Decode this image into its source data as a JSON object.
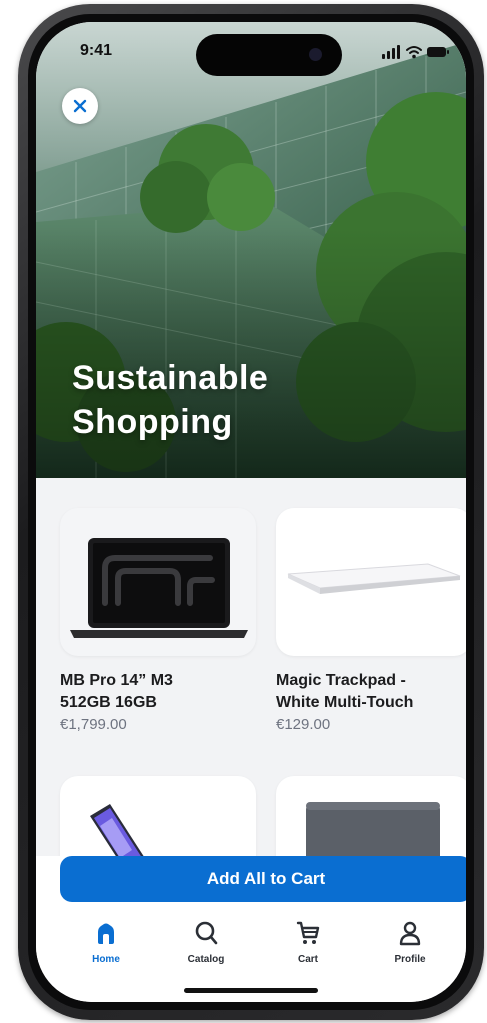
{
  "status_bar": {
    "time": "9:41"
  },
  "hero": {
    "title_line1": "Sustainable",
    "title_line2": "Shopping"
  },
  "products": [
    {
      "name_line1": "MB Pro 14” M3",
      "name_line2": "512GB 16GB",
      "price": "€1,799.00",
      "image": "laptop-image"
    },
    {
      "name_line1": "Magic Trackpad -",
      "name_line2": "White Multi-Touch",
      "price": "€129.00",
      "image": "trackpad-image"
    },
    {
      "name_line1": "",
      "name_line2": "",
      "price": "",
      "image": "tablet-image"
    },
    {
      "name_line1": "",
      "name_line2": "",
      "price": "",
      "image": "keyboard-image"
    }
  ],
  "cta": {
    "label": "Add All to Cart"
  },
  "tab_bar": {
    "items": [
      {
        "label": "Home",
        "icon": "home-icon",
        "active": true
      },
      {
        "label": "Catalog",
        "icon": "search-icon",
        "active": false
      },
      {
        "label": "Cart",
        "icon": "cart-icon",
        "active": false
      },
      {
        "label": "Profile",
        "icon": "profile-icon",
        "active": false
      }
    ]
  },
  "colors": {
    "accent": "#0a6ed1",
    "background": "#f2f3f5",
    "text": "#1c1c1e",
    "price": "#6e7380"
  }
}
